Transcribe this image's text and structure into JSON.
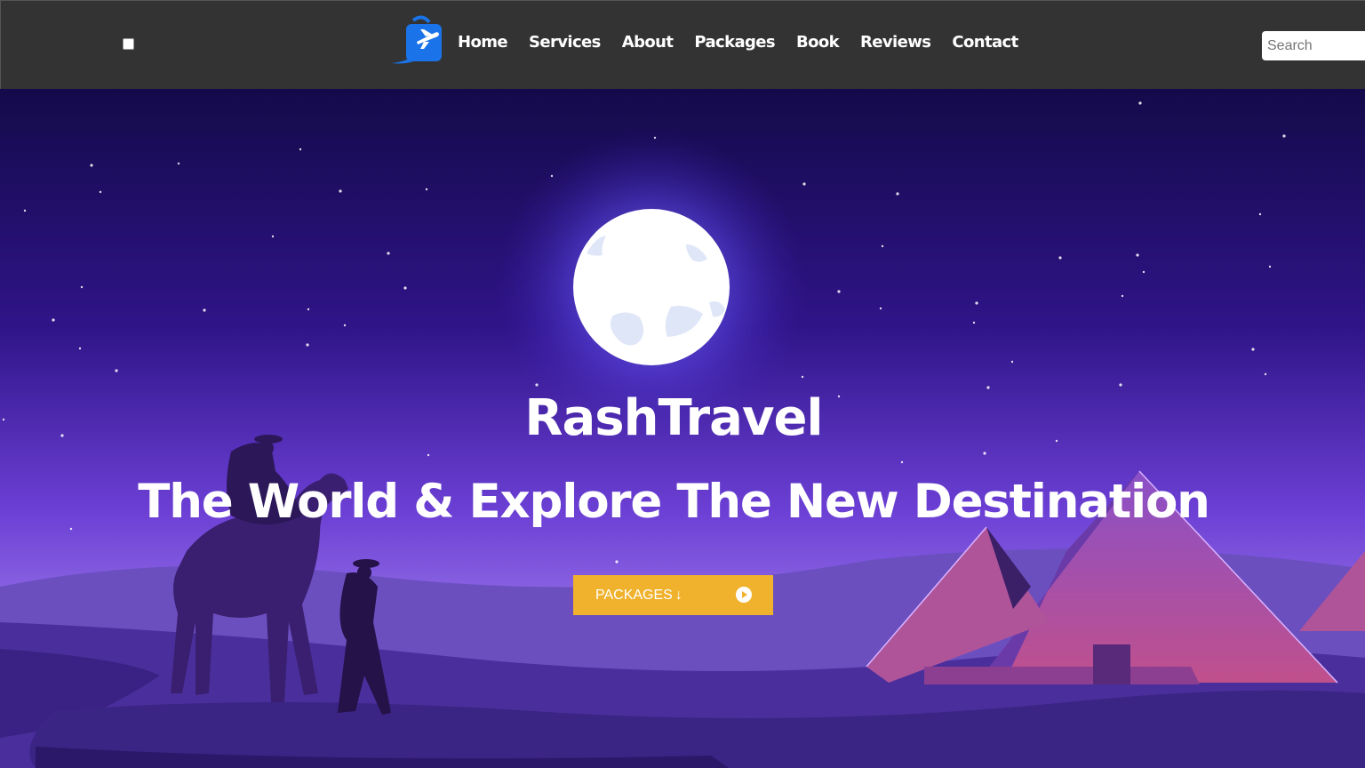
{
  "nav": {
    "links": [
      "Home",
      "Services",
      "About",
      "Packages",
      "Book",
      "Reviews",
      "Contact"
    ],
    "search_placeholder": "Search",
    "logo_icon": "travel-bag-plane-icon"
  },
  "hero": {
    "brand": "RashTravel",
    "tagline": "The World & Explore The New Destination",
    "cta_label": "PACKAGES",
    "cta_arrow": "↓",
    "background": "desert-night-pyramids-camel-illustration"
  },
  "colors": {
    "navbar_bg": "#333333",
    "accent": "#f0b22c",
    "logo_blue": "#1a73e8",
    "sky_top": "#140a4a",
    "sky_bottom": "#8a5ae0"
  }
}
